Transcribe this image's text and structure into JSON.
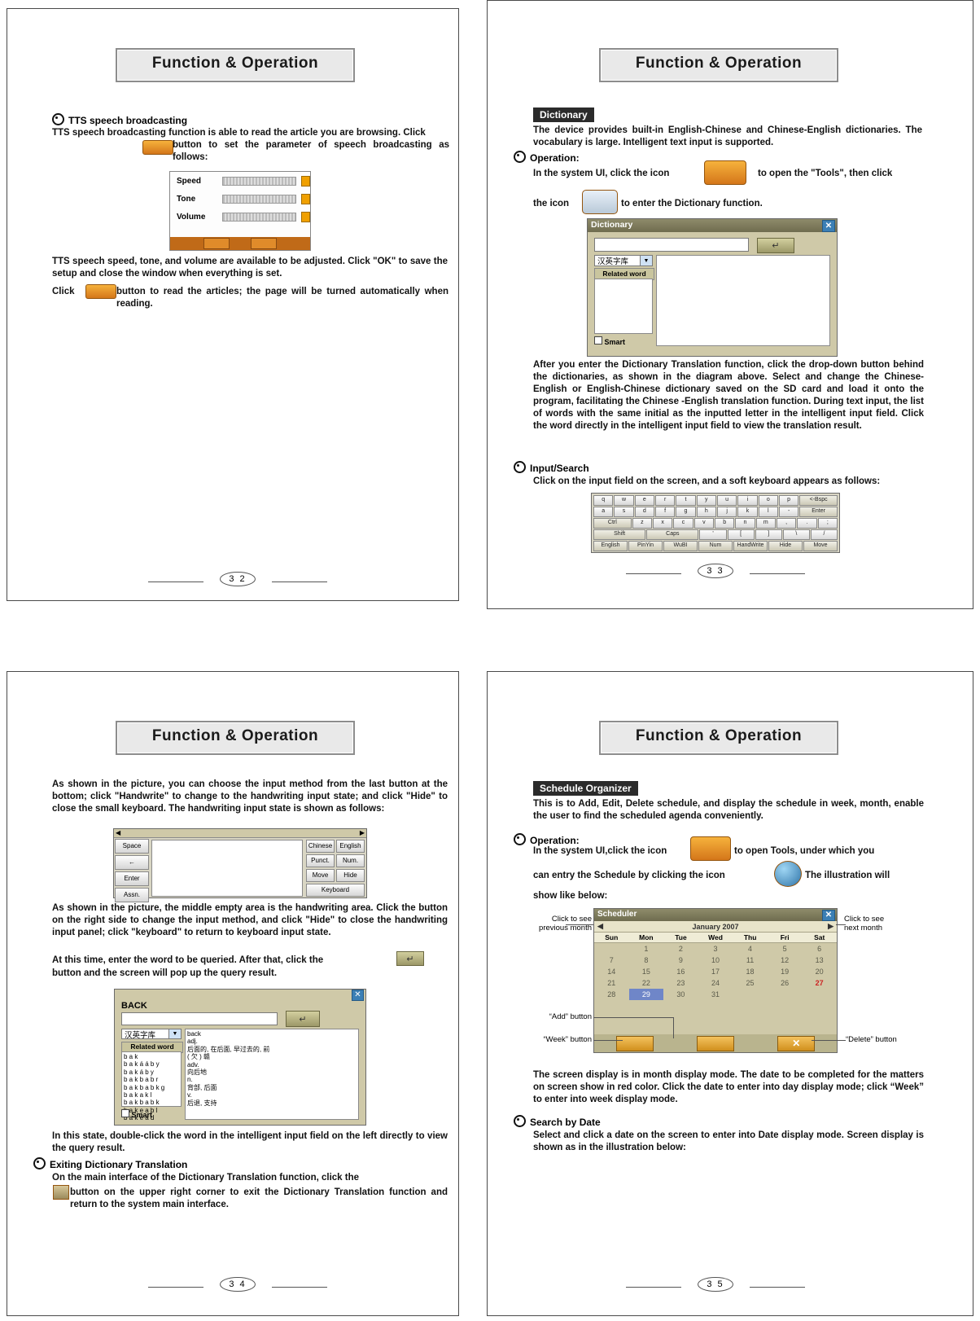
{
  "pages": {
    "p32": {
      "banner": "Function & Operation",
      "page_number": "3 2",
      "s1_title": "TTS speech broadcasting",
      "s1_p1": "TTS speech broadcasting function is able to read the article you are browsing. Click",
      "s1_p1b": "button to set the parameter of speech broadcasting as follows:",
      "tts": {
        "rows": [
          "Speed",
          "Tone",
          "Volume"
        ]
      },
      "s1_p2": "TTS speech speed, tone, and volume are available to be adjusted. Click \"OK\" to save the setup and close the window when everything is set.",
      "s1_p3a": "Click",
      "s1_p3b": "button to read the articles; the page will be turned automatically when reading."
    },
    "p33": {
      "banner": "Function & Operation",
      "page_number": "3 3",
      "section_label": "Dictionary",
      "intro": "The device provides built-in English-Chinese and Chinese-English dictionaries. The vocabulary is large. Intelligent text input is supported.",
      "op_title": "Operation:",
      "op_l1": "In the system UI, click the icon",
      "op_l2": "to open the \"Tools\", then click",
      "op_l3": "the icon",
      "op_l4": "to enter the Dictionary function.",
      "dict_window": {
        "title": "Dictionary",
        "close": "✕",
        "dropdown": "汉英字库",
        "related": "Related word",
        "smart": "Smart",
        "enter_icon": "↵"
      },
      "after_para": "After you enter the Dictionary Translation function, click the drop-down button behind the dictionaries, as shown in the diagram above. Select and change the Chinese-English or English-Chinese dictionary saved on the SD card and load it onto the program, facilitating the Chinese -English translation function. During text input, the list of words with the same initial as the inputted letter in the intelligent input field. Click the word directly in the intelligent input field to view the translation result.",
      "input_title": "Input/Search",
      "input_para": "Click on the input field on the screen, and a soft keyboard appears as follows:",
      "keyboard": {
        "row1": [
          "q",
          "w",
          "e",
          "r",
          "t",
          "y",
          "u",
          "i",
          "o",
          "p",
          "<-Bspc"
        ],
        "row2": [
          "a",
          "s",
          "d",
          "f",
          "g",
          "h",
          "j",
          "k",
          "l",
          "-",
          "Enter"
        ],
        "row3": [
          "Ctrl",
          "z",
          "x",
          "c",
          "v",
          "b",
          "n",
          "m",
          ",",
          ".",
          ";"
        ],
        "row4": [
          "Shift",
          "Caps",
          "'",
          "[",
          "]",
          "\\",
          "/"
        ],
        "row5": [
          "English",
          "PinYin",
          "WuBI",
          "Num",
          "HandWrite",
          "Hide",
          "Move"
        ]
      }
    },
    "p34": {
      "banner": "Function & Operation",
      "page_number": "3 4",
      "para1": "As shown in the picture, you can choose the input method from the last button at the bottom; click \"Handwrite\" to change to the handwriting input state; and click \"Hide\" to close the small keyboard. The handwriting input state is shown as follows:",
      "hand_panel": {
        "left_keys": [
          "Space",
          "←",
          "Enter",
          "Assn."
        ],
        "right_keys": [
          "Chinese",
          "English",
          "Punct.",
          "Num.",
          "Move",
          "Hide",
          "Keyboard"
        ]
      },
      "para2": "As shown in the picture, the middle empty area is the handwriting area. Click the button on the right side to change the input method, and click \"Hide\" to close the handwriting input panel; click \"keyboard\" to return to keyboard input state.",
      "para3a": "At this time, enter the word to be queried. After that, click the",
      "para3b": "button and the screen will pop up the query result.",
      "dict_result": {
        "title": "BACK",
        "close": "✕",
        "dropdown": "汉英字库",
        "related": "Related word",
        "smart": "Smart",
        "enter_icon": "↵",
        "left_list": [
          "b a k",
          "b a k á á b y",
          "b a k á b y",
          "b a k b a b r",
          "b a k b a b k g",
          "b a k a k l",
          "b a k b a b k",
          "b a k e a b l",
          "b a k e a d"
        ],
        "right_list": [
          "back",
          "adj.",
          "后面的, 在后面, 早过去的, 前",
          "( 欠 ) 赣",
          "adv.",
          "向后地",
          "n.",
          "背部, 后面",
          "v.",
          "后退, 支持"
        ]
      },
      "para4": "In this state, double-click the word in the intelligent input field on the left directly to view the query result.",
      "exit_title": "Exiting Dictionary Translation",
      "exit_para_a": "On the main interface of the Dictionary Translation function, click the",
      "exit_para_b": "button on the upper right corner to exit the Dictionary Translation function and return to the system main interface."
    },
    "p35": {
      "banner": "Function & Operation",
      "page_number": "3 5",
      "section_label": "Schedule Organizer",
      "intro": "This is to Add, Edit, Delete schedule, and display the schedule in week, month, enable the user to find the scheduled agenda conveniently.",
      "op_title": "Operation:",
      "op_l1": "In the system UI,click the icon",
      "op_l2": "to open Tools, under which you",
      "op_l3": "can entry the Schedule by clicking the icon",
      "op_l4": "The illustration will",
      "op_l5": "show like below:",
      "callouts": {
        "prev": "Click to see\nprevious month",
        "next": "Click to see\nnext month",
        "add": "“Add” button",
        "week": "“Week” button",
        "delete": "“Delete” button"
      },
      "scheduler": {
        "title": "Scheduler",
        "close": "✕",
        "month": "January 2007",
        "prev_arrow": "◀",
        "next_arrow": "▶",
        "dow": [
          "Sun",
          "Mon",
          "Tue",
          "Wed",
          "Thu",
          "Fri",
          "Sat"
        ],
        "blanks_before": 1,
        "days": [
          "1",
          "2",
          "3",
          "4",
          "5",
          "6",
          "7",
          "8",
          "9",
          "10",
          "11",
          "12",
          "13",
          "14",
          "15",
          "16",
          "17",
          "18",
          "19",
          "20",
          "21",
          "22",
          "23",
          "24",
          "25",
          "26",
          "27",
          "28",
          "29",
          "30",
          "31"
        ],
        "red_days": [
          "27"
        ],
        "selected_day": "29"
      },
      "para_after": "The screen display is in month display mode. The date to be completed for the matters on screen show in red color. Click the date to enter into day display mode; click “Week” to enter into week display mode.",
      "search_title": "Search by Date",
      "search_para": "Select and click a date on the screen to enter into Date display mode. Screen display is shown as in the illustration below:"
    }
  }
}
